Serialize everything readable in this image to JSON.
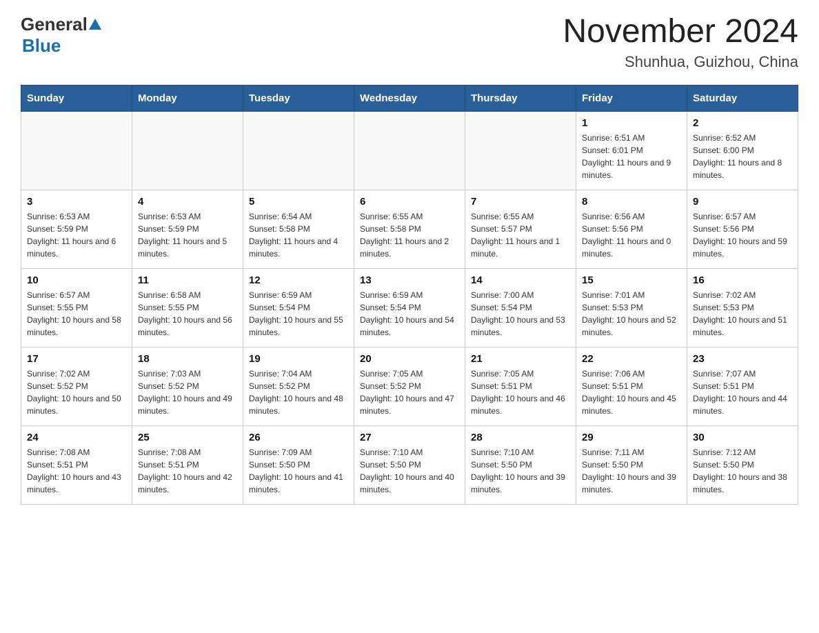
{
  "header": {
    "logo_general": "General",
    "logo_blue": "Blue",
    "month_year": "November 2024",
    "location": "Shunhua, Guizhou, China"
  },
  "weekdays": [
    "Sunday",
    "Monday",
    "Tuesday",
    "Wednesday",
    "Thursday",
    "Friday",
    "Saturday"
  ],
  "weeks": [
    [
      {
        "day": "",
        "info": ""
      },
      {
        "day": "",
        "info": ""
      },
      {
        "day": "",
        "info": ""
      },
      {
        "day": "",
        "info": ""
      },
      {
        "day": "",
        "info": ""
      },
      {
        "day": "1",
        "info": "Sunrise: 6:51 AM\nSunset: 6:01 PM\nDaylight: 11 hours and 9 minutes."
      },
      {
        "day": "2",
        "info": "Sunrise: 6:52 AM\nSunset: 6:00 PM\nDaylight: 11 hours and 8 minutes."
      }
    ],
    [
      {
        "day": "3",
        "info": "Sunrise: 6:53 AM\nSunset: 5:59 PM\nDaylight: 11 hours and 6 minutes."
      },
      {
        "day": "4",
        "info": "Sunrise: 6:53 AM\nSunset: 5:59 PM\nDaylight: 11 hours and 5 minutes."
      },
      {
        "day": "5",
        "info": "Sunrise: 6:54 AM\nSunset: 5:58 PM\nDaylight: 11 hours and 4 minutes."
      },
      {
        "day": "6",
        "info": "Sunrise: 6:55 AM\nSunset: 5:58 PM\nDaylight: 11 hours and 2 minutes."
      },
      {
        "day": "7",
        "info": "Sunrise: 6:55 AM\nSunset: 5:57 PM\nDaylight: 11 hours and 1 minute."
      },
      {
        "day": "8",
        "info": "Sunrise: 6:56 AM\nSunset: 5:56 PM\nDaylight: 11 hours and 0 minutes."
      },
      {
        "day": "9",
        "info": "Sunrise: 6:57 AM\nSunset: 5:56 PM\nDaylight: 10 hours and 59 minutes."
      }
    ],
    [
      {
        "day": "10",
        "info": "Sunrise: 6:57 AM\nSunset: 5:55 PM\nDaylight: 10 hours and 58 minutes."
      },
      {
        "day": "11",
        "info": "Sunrise: 6:58 AM\nSunset: 5:55 PM\nDaylight: 10 hours and 56 minutes."
      },
      {
        "day": "12",
        "info": "Sunrise: 6:59 AM\nSunset: 5:54 PM\nDaylight: 10 hours and 55 minutes."
      },
      {
        "day": "13",
        "info": "Sunrise: 6:59 AM\nSunset: 5:54 PM\nDaylight: 10 hours and 54 minutes."
      },
      {
        "day": "14",
        "info": "Sunrise: 7:00 AM\nSunset: 5:54 PM\nDaylight: 10 hours and 53 minutes."
      },
      {
        "day": "15",
        "info": "Sunrise: 7:01 AM\nSunset: 5:53 PM\nDaylight: 10 hours and 52 minutes."
      },
      {
        "day": "16",
        "info": "Sunrise: 7:02 AM\nSunset: 5:53 PM\nDaylight: 10 hours and 51 minutes."
      }
    ],
    [
      {
        "day": "17",
        "info": "Sunrise: 7:02 AM\nSunset: 5:52 PM\nDaylight: 10 hours and 50 minutes."
      },
      {
        "day": "18",
        "info": "Sunrise: 7:03 AM\nSunset: 5:52 PM\nDaylight: 10 hours and 49 minutes."
      },
      {
        "day": "19",
        "info": "Sunrise: 7:04 AM\nSunset: 5:52 PM\nDaylight: 10 hours and 48 minutes."
      },
      {
        "day": "20",
        "info": "Sunrise: 7:05 AM\nSunset: 5:52 PM\nDaylight: 10 hours and 47 minutes."
      },
      {
        "day": "21",
        "info": "Sunrise: 7:05 AM\nSunset: 5:51 PM\nDaylight: 10 hours and 46 minutes."
      },
      {
        "day": "22",
        "info": "Sunrise: 7:06 AM\nSunset: 5:51 PM\nDaylight: 10 hours and 45 minutes."
      },
      {
        "day": "23",
        "info": "Sunrise: 7:07 AM\nSunset: 5:51 PM\nDaylight: 10 hours and 44 minutes."
      }
    ],
    [
      {
        "day": "24",
        "info": "Sunrise: 7:08 AM\nSunset: 5:51 PM\nDaylight: 10 hours and 43 minutes."
      },
      {
        "day": "25",
        "info": "Sunrise: 7:08 AM\nSunset: 5:51 PM\nDaylight: 10 hours and 42 minutes."
      },
      {
        "day": "26",
        "info": "Sunrise: 7:09 AM\nSunset: 5:50 PM\nDaylight: 10 hours and 41 minutes."
      },
      {
        "day": "27",
        "info": "Sunrise: 7:10 AM\nSunset: 5:50 PM\nDaylight: 10 hours and 40 minutes."
      },
      {
        "day": "28",
        "info": "Sunrise: 7:10 AM\nSunset: 5:50 PM\nDaylight: 10 hours and 39 minutes."
      },
      {
        "day": "29",
        "info": "Sunrise: 7:11 AM\nSunset: 5:50 PM\nDaylight: 10 hours and 39 minutes."
      },
      {
        "day": "30",
        "info": "Sunrise: 7:12 AM\nSunset: 5:50 PM\nDaylight: 10 hours and 38 minutes."
      }
    ]
  ]
}
